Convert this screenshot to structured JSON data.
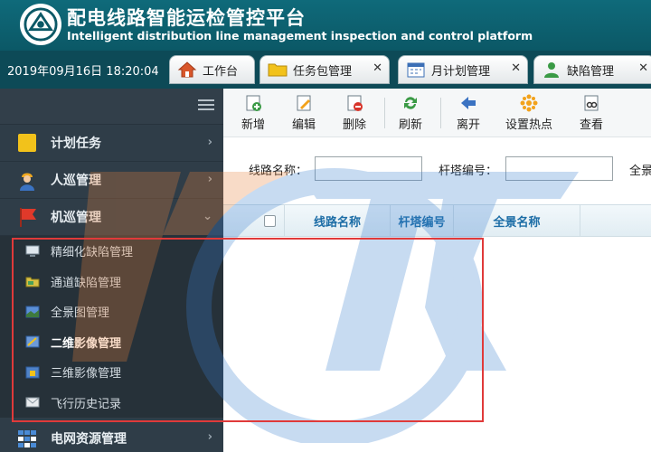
{
  "header": {
    "title_cn": "配电线路智能运检管控平台",
    "title_en": "Intelligent distribution line management inspection and control platform"
  },
  "tabbar": {
    "datetime": "2019年09月16日  18:20:04",
    "tabs": [
      {
        "label": "工作台",
        "icon": "home-icon",
        "closable": false
      },
      {
        "label": "任务包管理",
        "icon": "folder-icon",
        "closable": true
      },
      {
        "label": "月计划管理",
        "icon": "calendar-icon",
        "closable": true
      },
      {
        "label": "缺陷管理",
        "icon": "user-icon",
        "closable": true
      }
    ]
  },
  "sidebar": {
    "items": [
      {
        "label": "计划任务",
        "icon": "note-icon",
        "chevron": "›"
      },
      {
        "label": "人巡管理",
        "icon": "worker-icon",
        "chevron": "›"
      },
      {
        "label": "机巡管理",
        "icon": "flag-icon",
        "chevron": "⌄"
      }
    ],
    "subitems": [
      {
        "label": "精细化缺陷管理",
        "icon": "monitor-icon"
      },
      {
        "label": "通道缺陷管理",
        "icon": "folder-icon"
      },
      {
        "label": "全景图管理",
        "icon": "panorama-icon"
      },
      {
        "label": "二维影像管理",
        "icon": "image-2d-icon"
      },
      {
        "label": "三维影像管理",
        "icon": "image-3d-icon"
      },
      {
        "label": "飞行历史记录",
        "icon": "envelope-icon"
      }
    ],
    "bottom_item": {
      "label": "电网资源管理",
      "icon": "grid-icon",
      "chevron": "›"
    }
  },
  "toolbar": {
    "buttons": [
      {
        "label": "新增",
        "icon": "add-icon"
      },
      {
        "label": "编辑",
        "icon": "edit-icon"
      },
      {
        "label": "删除",
        "icon": "delete-icon"
      },
      {
        "label": "刷新",
        "icon": "refresh-icon"
      },
      {
        "label": "离开",
        "icon": "exit-icon"
      },
      {
        "label": "设置热点",
        "icon": "hotspot-icon"
      },
      {
        "label": "查看",
        "icon": "view-icon"
      }
    ]
  },
  "filter": {
    "line_name_label": "线路名称：",
    "tower_no_label": "杆塔编号：",
    "panorama_label": "全景"
  },
  "grid": {
    "columns": [
      "线路名称",
      "杆塔编号",
      "全景名称"
    ]
  },
  "colors": {
    "header_bg": "#0f6a7a",
    "tabbar_bg": "#0d4a57",
    "sidebar_bg": "#2f3d48",
    "grid_header_text": "#1c6da6",
    "annotation_red": "#e03a3a"
  }
}
